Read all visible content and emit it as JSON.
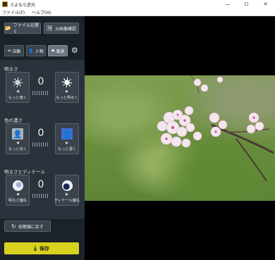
{
  "window": {
    "title": "さよなら逆光",
    "minimize": "—",
    "maximize": "☐",
    "close": "✕"
  },
  "menu": [
    "ファイル(F)",
    "ヘルプ(H)"
  ],
  "toolbar": {
    "open_file": "ファイルを開く",
    "view_original": "元画像確認"
  },
  "tabs": {
    "auto": "自動",
    "person": "人物",
    "landscape": "風景",
    "active": "landscape"
  },
  "brightness": {
    "title": "明るさ",
    "value": "0",
    "minus_label": "もっと暗く",
    "plus_label": "もっと明るく"
  },
  "color_depth": {
    "title": "色の濃さ",
    "value": "0",
    "minus_label": "もっと淡く",
    "plus_label": "もっと濃く"
  },
  "brightness_detail": {
    "title": "明るさとディテール",
    "value": "0",
    "minus_label": "明るさ優先",
    "plus_label": "ディテール優先"
  },
  "reset_label": "初期値に戻す",
  "save_label": "保存",
  "colors": {
    "sidebar": "#1c222a",
    "save_accent": "#d8d21e",
    "viewer_bg": "#000000"
  }
}
